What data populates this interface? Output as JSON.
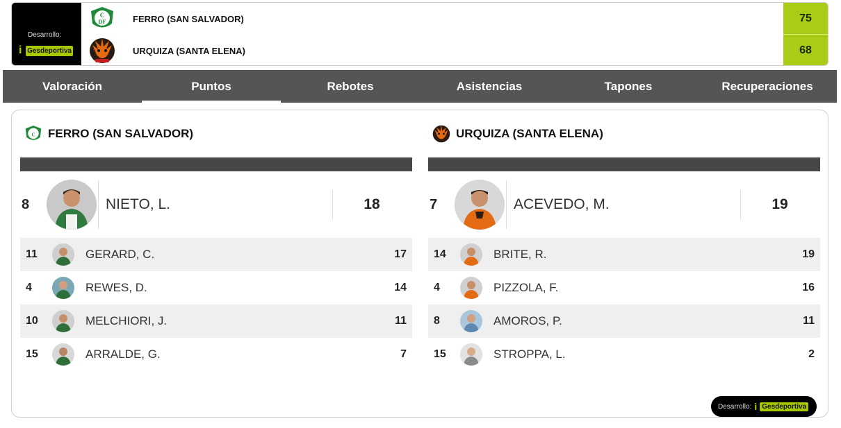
{
  "brand": {
    "caption": "Desarrollo:",
    "logo_text": "Gesdeportiva",
    "logo_color": "#a8c800"
  },
  "scoreboard": {
    "home": {
      "name": "FERRO (SAN SALVADOR)",
      "score": "75",
      "crest_icon": "ferro-crest-icon",
      "crest_color": "#1f8a3a"
    },
    "away": {
      "name": "URQUIZA (SANTA ELENA)",
      "score": "68",
      "crest_icon": "urquiza-crest-icon",
      "crest_color": "#e46a14"
    },
    "score_bg": "#a9cc17"
  },
  "tabs": [
    {
      "label": "Valoración",
      "active": false
    },
    {
      "label": "Puntos",
      "active": true
    },
    {
      "label": "Rebotes",
      "active": false
    },
    {
      "label": "Asistencias",
      "active": false
    },
    {
      "label": "Tapones",
      "active": false
    },
    {
      "label": "Recuperaciones",
      "active": false
    }
  ],
  "panel": {
    "home": {
      "team": "FERRO (SAN SALVADOR)",
      "leader": {
        "number": "8",
        "name": "NIETO, L.",
        "value": "18"
      },
      "players": [
        {
          "number": "11",
          "name": "GERARD, C.",
          "value": "17"
        },
        {
          "number": "4",
          "name": "REWES, D.",
          "value": "14"
        },
        {
          "number": "10",
          "name": "MELCHIORI, J.",
          "value": "11"
        },
        {
          "number": "15",
          "name": "ARRALDE, G.",
          "value": "7"
        }
      ]
    },
    "away": {
      "team": "URQUIZA (SANTA ELENA)",
      "leader": {
        "number": "7",
        "name": "ACEVEDO, M.",
        "value": "19"
      },
      "players": [
        {
          "number": "14",
          "name": "BRITE, R.",
          "value": "19"
        },
        {
          "number": "4",
          "name": "PIZZOLA, F.",
          "value": "16"
        },
        {
          "number": "8",
          "name": "AMOROS, P.",
          "value": "11"
        },
        {
          "number": "15",
          "name": "STROPPA, L.",
          "value": "2"
        }
      ]
    }
  },
  "footer": {
    "caption": "Desarrollo:",
    "logo_text": "Gesdeportiva"
  }
}
